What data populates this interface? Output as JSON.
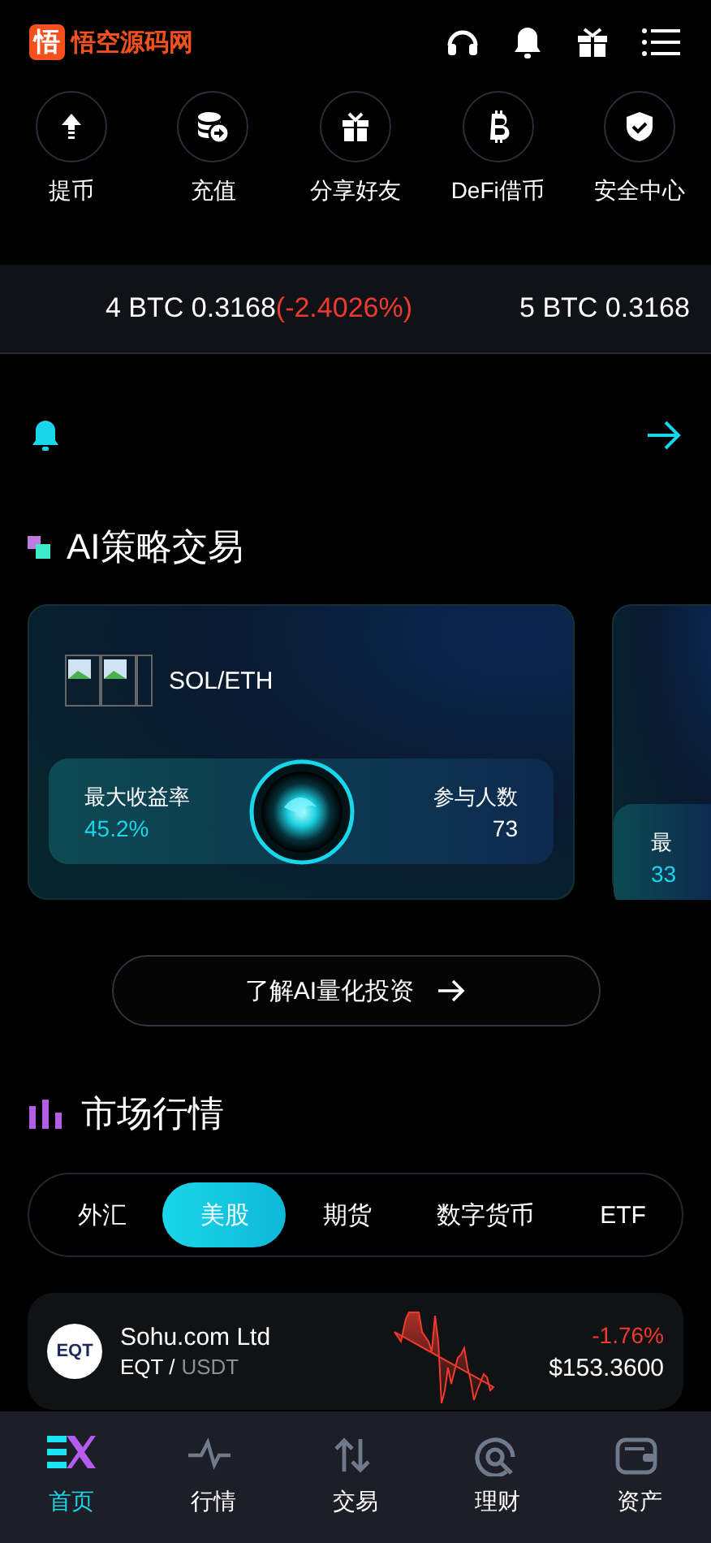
{
  "header": {
    "logo_mark": "悟",
    "logo_text": "悟空源码网"
  },
  "quick_actions": [
    {
      "label": "提币"
    },
    {
      "label": "充值"
    },
    {
      "label": "分享好友"
    },
    {
      "label": "DeFi借币"
    },
    {
      "label": "安全中心"
    }
  ],
  "ticker": [
    {
      "text": "4 BTC 0.3168",
      "change": "(-2.4026%)"
    },
    {
      "text": "5 BTC 0.3168"
    }
  ],
  "ai_section": {
    "title": "AI策略交易",
    "cards": [
      {
        "pair": "SOL/ETH",
        "rate_label": "最大收益率",
        "rate": "45.2%",
        "people_label": "参与人数",
        "people": "73"
      },
      {
        "rate_label": "最",
        "rate": "33"
      }
    ],
    "learn_button": "了解AI量化投资"
  },
  "market": {
    "title": "市场行情",
    "tabs": [
      {
        "label": "外汇",
        "selected": false
      },
      {
        "label": "美股",
        "selected": true
      },
      {
        "label": "期货",
        "selected": false
      },
      {
        "label": "数字货币",
        "selected": false
      },
      {
        "label": "ETF",
        "selected": false
      }
    ],
    "rows": [
      {
        "logo": "EQT",
        "name": "Sohu.com Ltd",
        "symbol": "EQT /",
        "quote": "USDT",
        "change": "-1.76%",
        "price": "$153.3600"
      }
    ]
  },
  "bottom_nav": [
    {
      "label": "首页",
      "selected": true
    },
    {
      "label": "行情",
      "selected": false
    },
    {
      "label": "交易",
      "selected": false
    },
    {
      "label": "理财",
      "selected": false
    },
    {
      "label": "资产",
      "selected": false
    }
  ]
}
